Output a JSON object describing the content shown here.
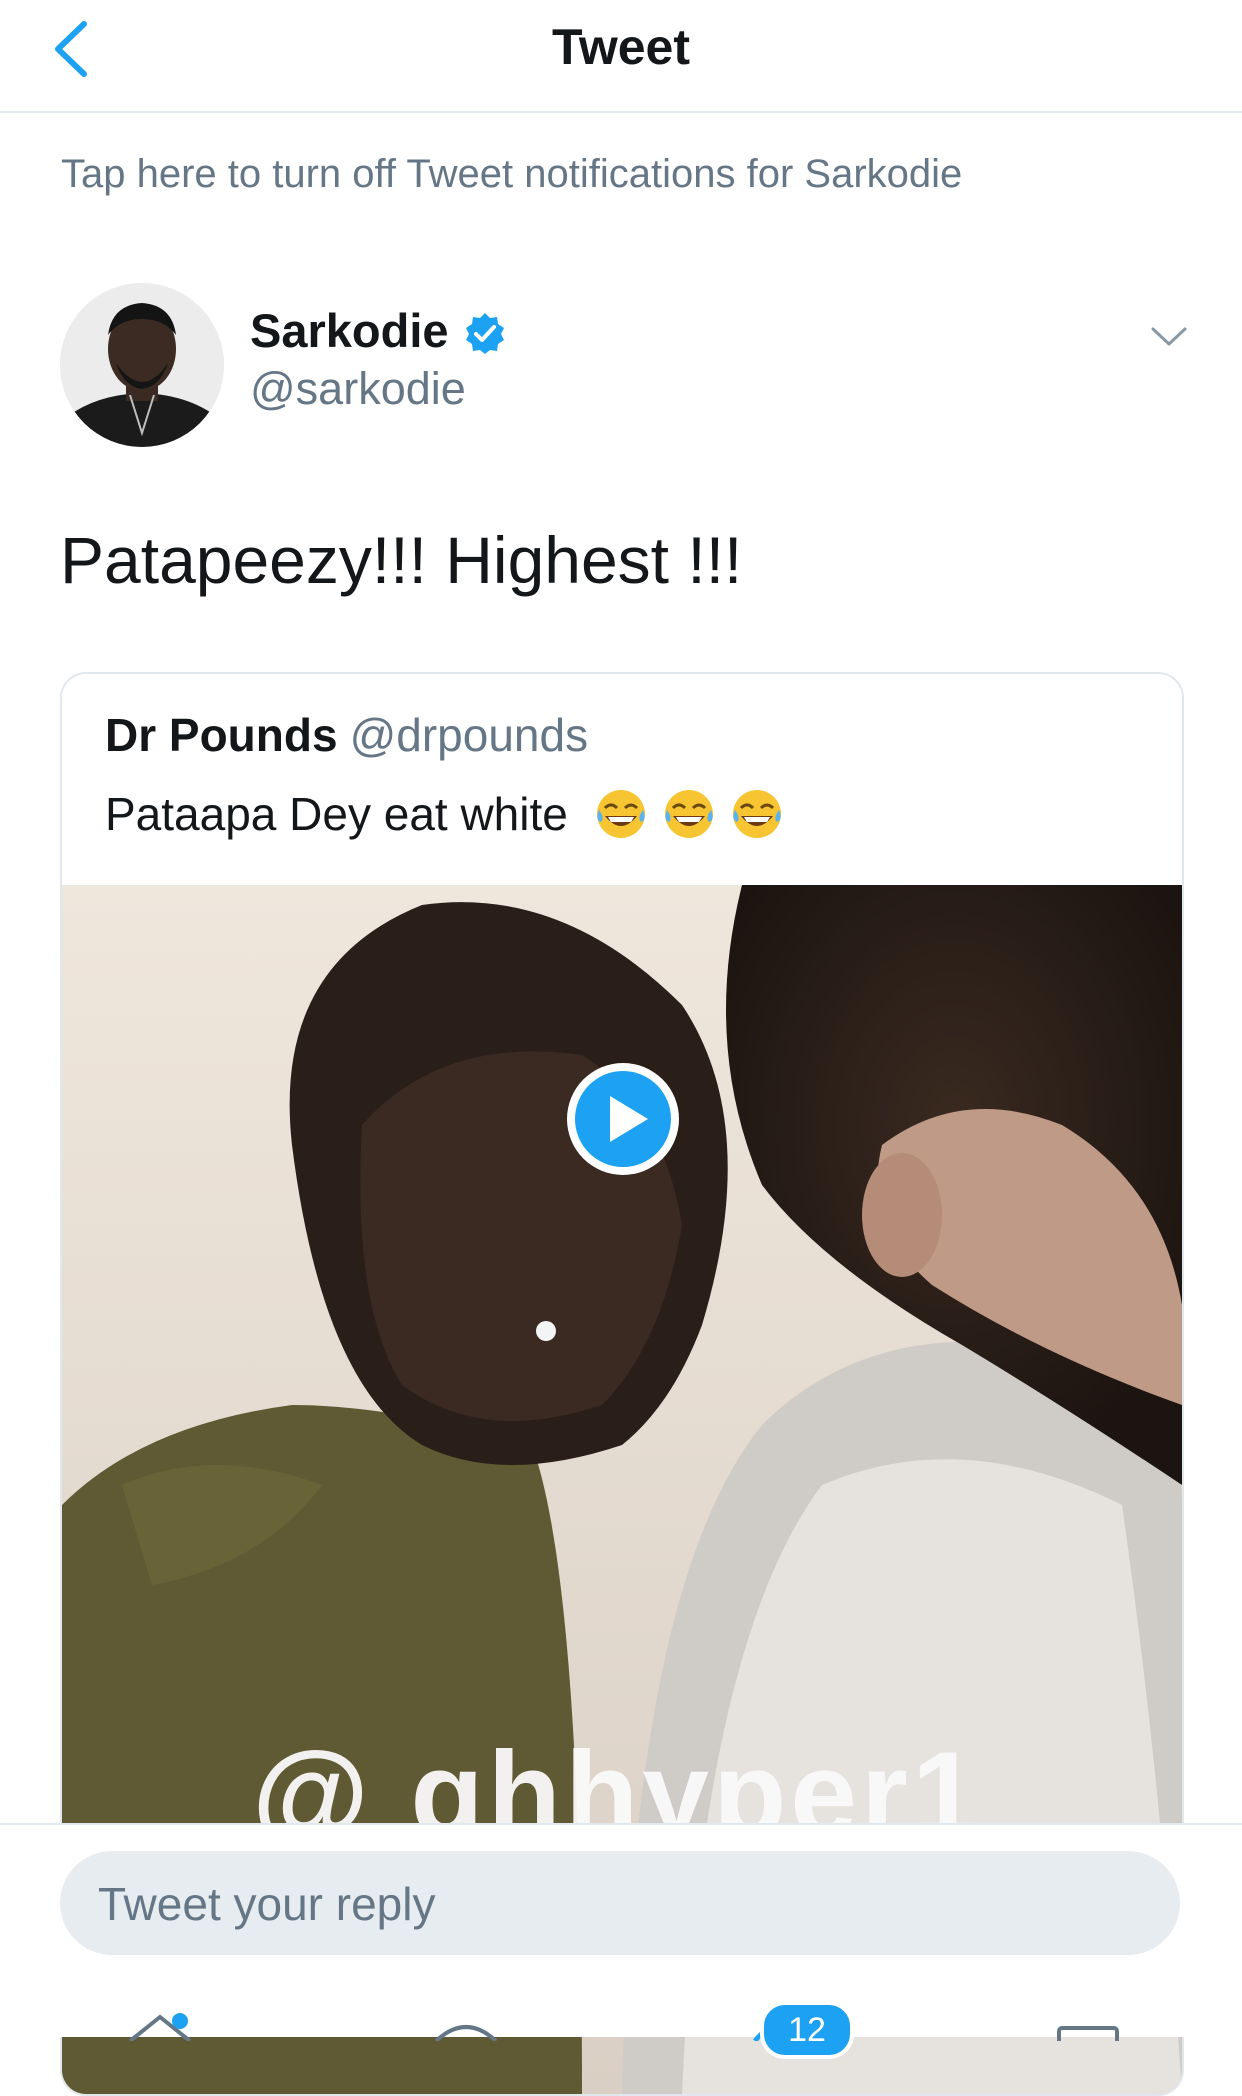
{
  "nav": {
    "title": "Tweet"
  },
  "notification_text": "Tap here to turn off Tweet notifications for Sarkodie",
  "tweet": {
    "author_name": "Sarkodie",
    "author_handle": "@sarkodie",
    "text": "Patapeezy!!! Highest !!!"
  },
  "quoted": {
    "author_name": "Dr Pounds",
    "author_handle": "@drpounds",
    "text": "Pataapa Dey eat white",
    "video_watermark": "@ ghhyper1"
  },
  "reply": {
    "placeholder": "Tweet your reply"
  },
  "tabbar": {
    "notifications_badge": "12"
  },
  "colors": {
    "accent": "#1da1f2",
    "secondary_text": "#657786",
    "divider": "#e1e8ed"
  }
}
